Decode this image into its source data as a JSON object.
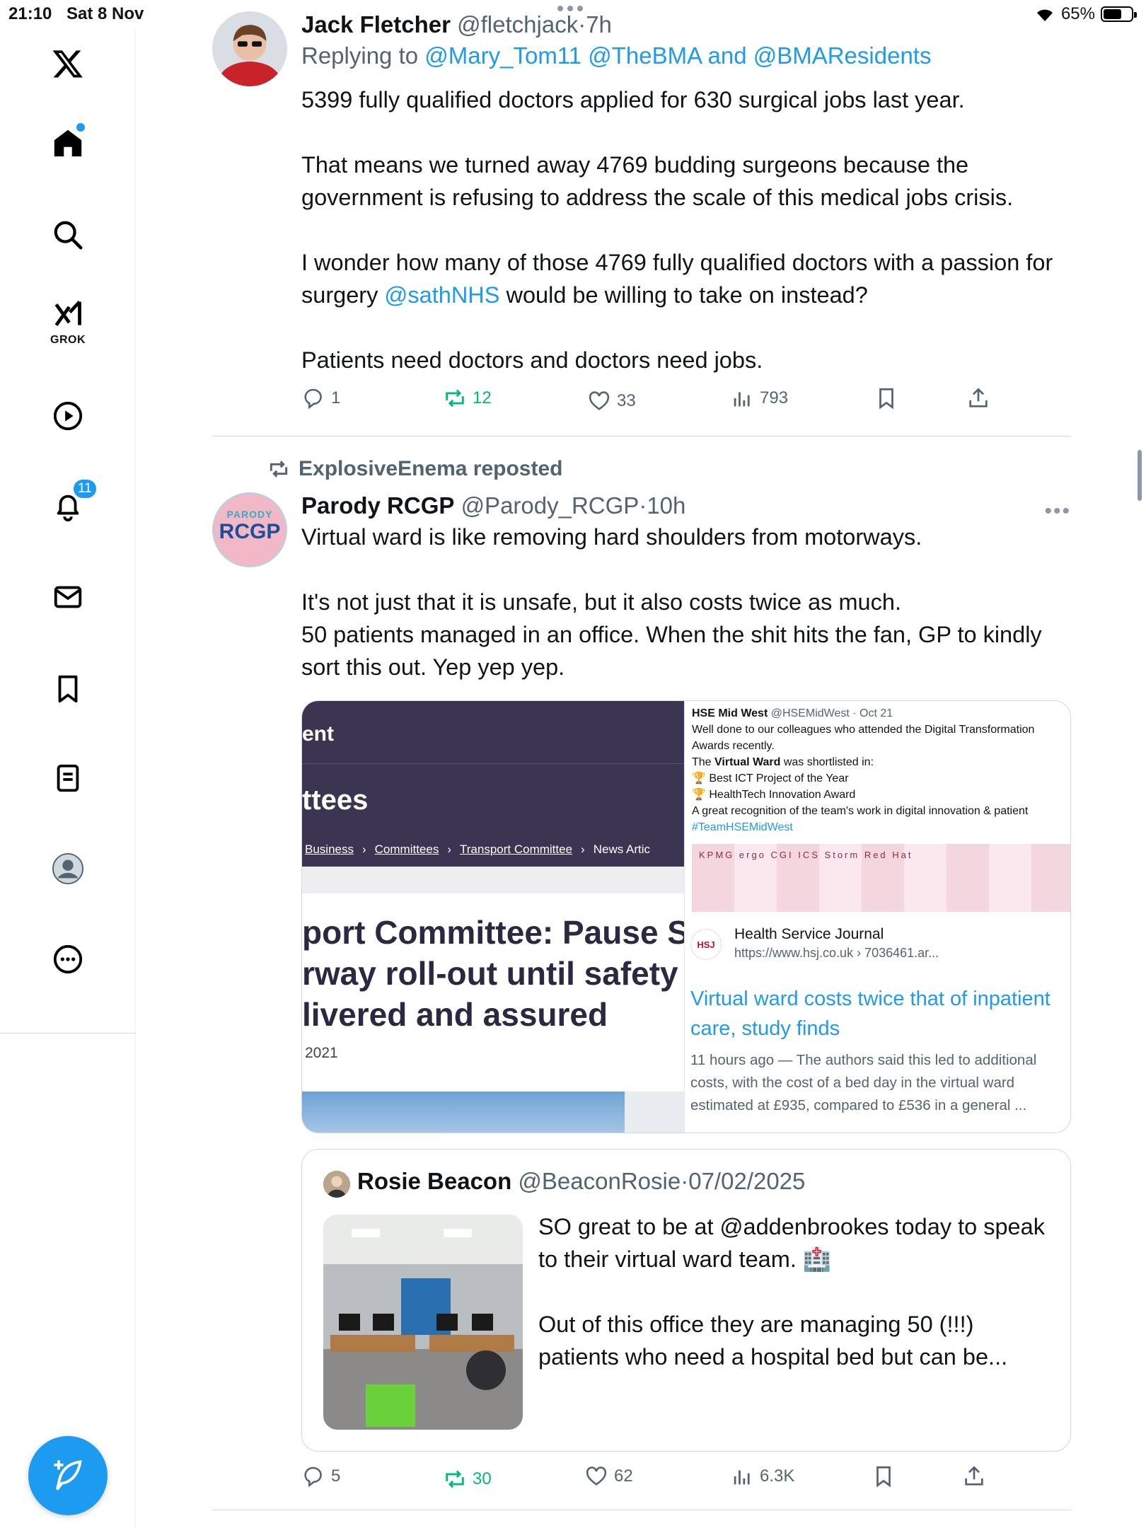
{
  "status_bar": {
    "time": "21:10",
    "date": "Sat 8 Nov",
    "battery": "65%",
    "battery_level": 0.65
  },
  "sidebar": {
    "grok_label": "GROK",
    "notification_count": "11"
  },
  "tweet1": {
    "name": "Jack Fletcher",
    "handle": "@fletchjack",
    "dot": "·",
    "time": "7h",
    "replying_prefix": "Replying to",
    "reply_mention_1": "@Mary_Tom11",
    "reply_mention_2": "@TheBMA",
    "reply_and": "and",
    "reply_mention_3": "@BMAResidents",
    "p1": "5399 fully qualified doctors applied for 630 surgical jobs last year.",
    "p2": "That means we turned away 4769 budding surgeons because the government is refusing to address the scale of this medical jobs crisis.",
    "p3_a": "I wonder how many of those 4769 fully qualified doctors with a passion for surgery",
    "p3_mention": "@sathNHS",
    "p3_b": "would be willing to take on instead?",
    "p4": "Patients need doctors and doctors need jobs.",
    "replies": "1",
    "reposts": "12",
    "likes": "33",
    "views": "793"
  },
  "repost_banner": {
    "text": "ExplosiveEnema reposted"
  },
  "tweet2": {
    "avatar_top": "PARODY",
    "avatar_main": "RCGP",
    "name": "Parody RCGP",
    "handle": "@Parody_RCGP",
    "dot": "·",
    "time": "10h",
    "p1": "Virtual ward is like removing hard shoulders from motorways.",
    "p2": "It's not just that it is unsafe, but it also costs twice as much.",
    "p3": "50 patients managed in an office. When the shit hits the fan, GP to kindly sort this out. Yep yep yep.",
    "replies": "5",
    "reposts": "30",
    "likes": "62",
    "views": "6.3K"
  },
  "media_left": {
    "word1": "ent",
    "word2": "ttees",
    "crumb1": "Business",
    "crumb2": "Committees",
    "crumb3": "Transport Committee",
    "crumb4": "News Artic",
    "headline1": "port Committee: Pause S",
    "headline2": "rway roll-out until safety",
    "headline3": "livered and assured",
    "year": "2021"
  },
  "media_right": {
    "author": "HSE Mid West",
    "author_meta": "@HSEMidWest · Oct 21",
    "line1": "Well done to our colleagues who attended the Digital Transformation Awards recently.",
    "line2_pre": "The",
    "line2_bold": "Virtual Ward",
    "line2_post": "was shortlisted in:",
    "line3": "🏆 Best ICT Project of the Year",
    "line4": "🏆 HealthTech Innovation Award",
    "line5": "A great recognition of the team's work in digital innovation & patient",
    "hashtag": "#TeamHSEMidWest",
    "photo_text": "KPMG  ergo  CGI  ICS  Storm  Red Hat",
    "source_logo": "HSJ",
    "source_name": "Health Service Journal",
    "source_url": "https://www.hsj.co.uk › 7036461.ar...",
    "link_title": "Virtual ward costs twice that of inpatient care, study finds",
    "link_desc": "11 hours ago — The authors said this led to additional costs, with the cost of a bed day in the virtual ward estimated at £935, compared to £536 in a general ..."
  },
  "quote": {
    "name": "Rosie Beacon",
    "handle": "@BeaconRosie",
    "dot": "·",
    "date": "07/02/2025",
    "p1": "SO great to be at @addenbrookes today to speak to their virtual ward team. 🏥",
    "p2": "Out of this office they are managing 50 (!!!) patients who need a hospital bed but can be..."
  }
}
